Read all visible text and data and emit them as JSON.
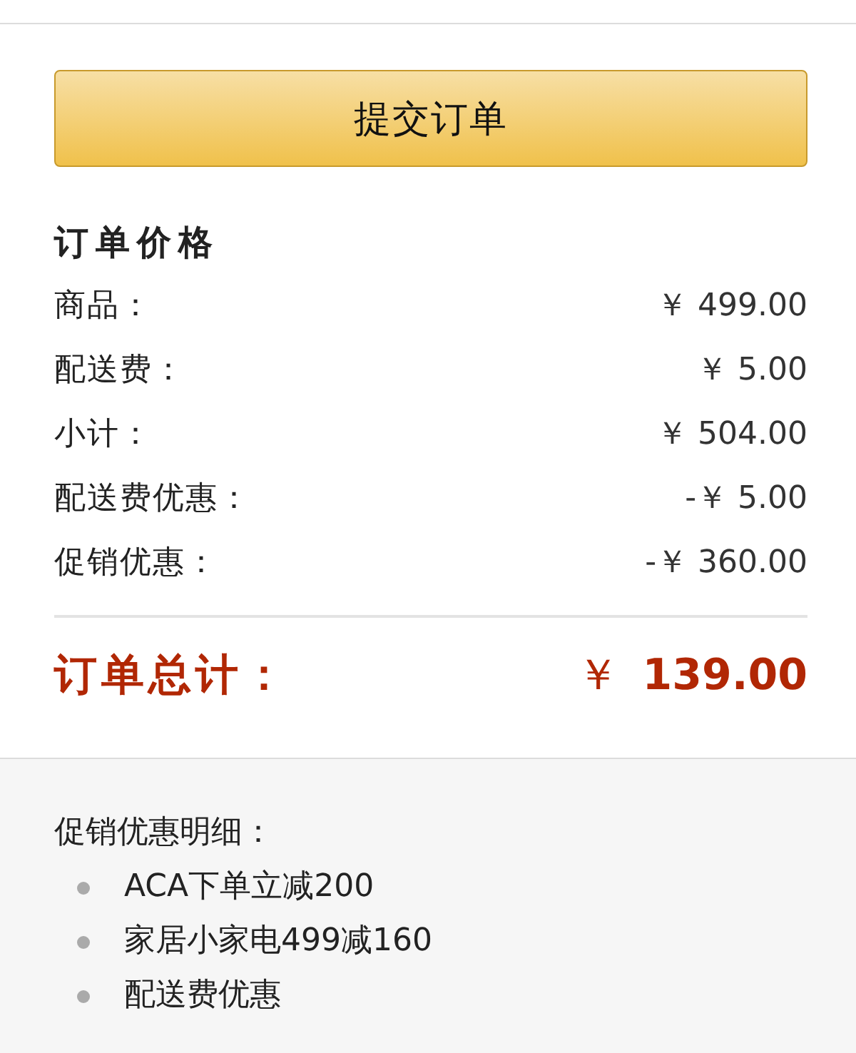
{
  "submit_button": {
    "label": "提交订单"
  },
  "order_price": {
    "title": "订单价格",
    "rows": [
      {
        "label": "商品：",
        "value": "￥ 499.00"
      },
      {
        "label": "配送费：",
        "value": "￥ 5.00"
      },
      {
        "label": "小计：",
        "value": "￥ 504.00"
      },
      {
        "label": "配送费优惠：",
        "value": "-￥ 5.00"
      },
      {
        "label": "促销优惠：",
        "value": "-￥ 360.00"
      }
    ],
    "total": {
      "label": "订单总计：",
      "currency": "￥",
      "amount": "139.00"
    }
  },
  "promotion_details": {
    "title": "促销优惠明细：",
    "items": [
      "ACA下单立减200",
      "家居小家电499减160",
      "配送费优惠"
    ]
  }
}
